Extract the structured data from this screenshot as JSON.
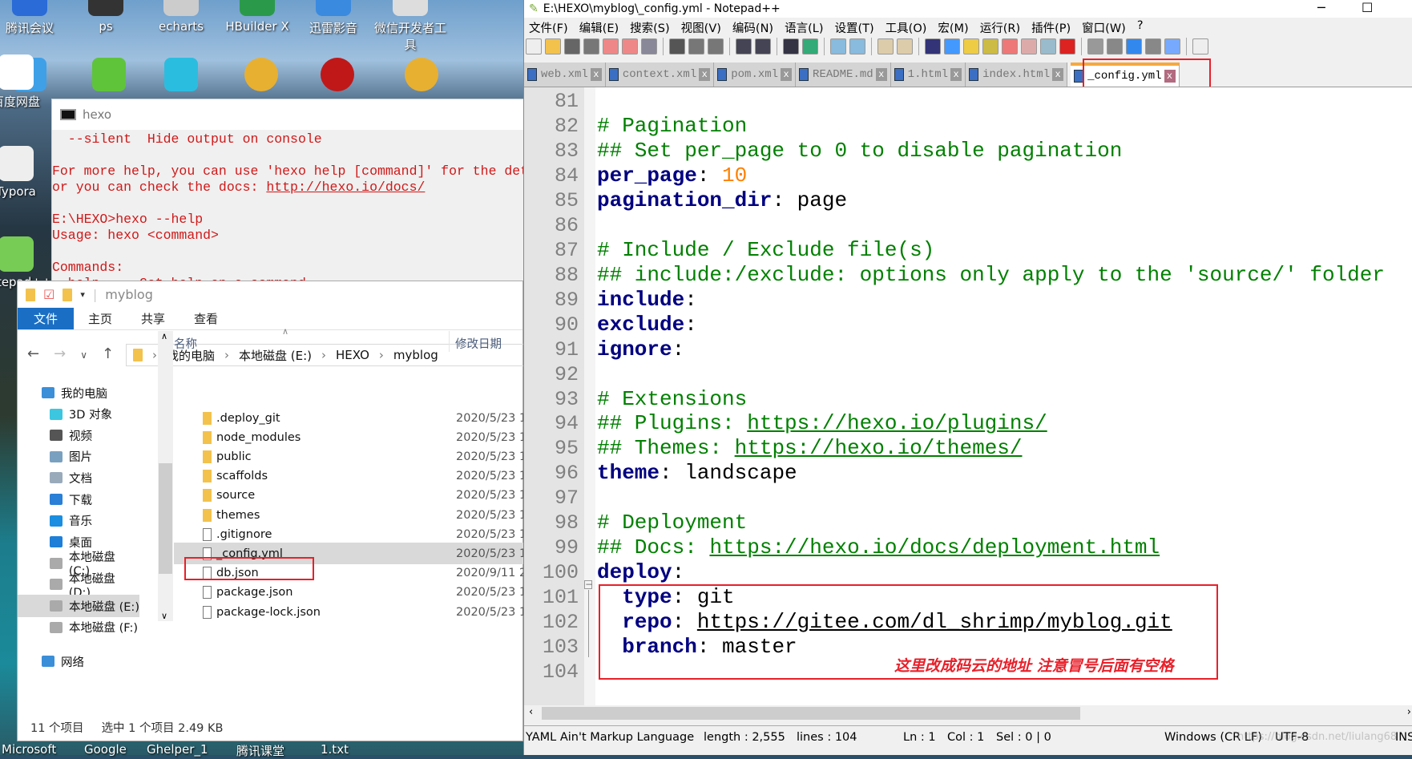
{
  "desktop": {
    "icons_top": [
      "腾讯会议",
      "ps",
      "echarts",
      "HBuilder X",
      "迅雷影音",
      "微信开发者工具"
    ],
    "icons_left": [
      "百度网盘",
      "Typora",
      "Notepad++"
    ],
    "taskbar_labels": [
      "Microsoft",
      "Google",
      "Ghelper_1",
      "腾讯课堂",
      "1.txt"
    ]
  },
  "console": {
    "title": "hexo",
    "lines": [
      "  --silent  Hide output on console",
      "",
      "For more help, you can use 'hexo help [command]' for the detailed information",
      "or you can check the docs: ",
      "",
      "E:\\HEXO>hexo --help",
      "Usage: hexo <command>",
      "",
      "Commands:",
      "  help     Get help on a command"
    ],
    "docs_link": "http://hexo.io/docs/"
  },
  "explorer": {
    "title": "myblog",
    "ribbon_tabs": [
      "文件",
      "主页",
      "共享",
      "查看"
    ],
    "breadcrumb": [
      "我的电脑",
      "本地磁盘 (E:)",
      "HEXO",
      "myblog"
    ],
    "nav_items": [
      {
        "label": "我的电脑",
        "icon": "computer-icon",
        "color": "#3a8fd8"
      },
      {
        "label": "3D 对象",
        "icon": "cube-icon",
        "color": "#3cc6e0"
      },
      {
        "label": "视频",
        "icon": "video-icon",
        "color": "#555"
      },
      {
        "label": "图片",
        "icon": "picture-icon",
        "color": "#7aa0c0"
      },
      {
        "label": "文档",
        "icon": "document-icon",
        "color": "#9ab"
      },
      {
        "label": "下载",
        "icon": "download-icon",
        "color": "#2a7fd6"
      },
      {
        "label": "音乐",
        "icon": "music-icon",
        "color": "#1a8ee0"
      },
      {
        "label": "桌面",
        "icon": "desktop-icon",
        "color": "#1e7fd8"
      },
      {
        "label": "本地磁盘 (C:)",
        "icon": "drive-icon",
        "color": "#aaa"
      },
      {
        "label": "本地磁盘 (D:)",
        "icon": "drive-icon",
        "color": "#aaa"
      },
      {
        "label": "本地磁盘 (E:)",
        "icon": "drive-icon",
        "color": "#aaa",
        "selected": true
      },
      {
        "label": "本地磁盘 (F:)",
        "icon": "drive-icon",
        "color": "#aaa"
      },
      {
        "label": "网络",
        "icon": "network-icon",
        "color": "#3a8fd8"
      }
    ],
    "columns": [
      "名称",
      "修改日期"
    ],
    "files": [
      {
        "name": ".deploy_git",
        "date": "2020/5/23 1",
        "type": "folder"
      },
      {
        "name": "node_modules",
        "date": "2020/5/23 1",
        "type": "folder"
      },
      {
        "name": "public",
        "date": "2020/5/23 1",
        "type": "folder"
      },
      {
        "name": "scaffolds",
        "date": "2020/5/23 1",
        "type": "folder"
      },
      {
        "name": "source",
        "date": "2020/5/23 1",
        "type": "folder"
      },
      {
        "name": "themes",
        "date": "2020/5/23 1",
        "type": "folder"
      },
      {
        "name": ".gitignore",
        "date": "2020/5/23 1",
        "type": "text"
      },
      {
        "name": "_config.yml",
        "date": "2020/5/23 1",
        "type": "file",
        "selected": true
      },
      {
        "name": "db.json",
        "date": "2020/9/11 2",
        "type": "json"
      },
      {
        "name": "package.json",
        "date": "2020/5/23 1",
        "type": "json"
      },
      {
        "name": "package-lock.json",
        "date": "2020/5/23 1",
        "type": "json"
      }
    ],
    "status_count": "11 个项目",
    "status_selected": "选中 1 个项目  2.49 KB"
  },
  "notepad": {
    "title": "E:\\HEXO\\myblog\\_config.yml - Notepad++",
    "menu": [
      "文件(F)",
      "编辑(E)",
      "搜索(S)",
      "视图(V)",
      "编码(N)",
      "语言(L)",
      "设置(T)",
      "工具(O)",
      "宏(M)",
      "运行(R)",
      "插件(P)",
      "窗口(W)",
      "?"
    ],
    "toolbar_icons": [
      "new-icon",
      "open-icon",
      "save-icon",
      "save-all-icon",
      "close-icon",
      "close-all-icon",
      "print-icon",
      "|",
      "cut-icon",
      "copy-icon",
      "paste-icon",
      "|",
      "undo-icon",
      "redo-icon",
      "|",
      "find-icon",
      "replace-icon",
      "|",
      "zoom-in-icon",
      "zoom-out-icon",
      "|",
      "sync-v-icon",
      "sync-h-icon",
      "|",
      "wrap-icon",
      "all-chars-icon",
      "indent-guide-icon",
      "udl-icon",
      "doc-map-icon",
      "function-list-icon",
      "folder-workspace-icon",
      "monitor-icon",
      "|",
      "record-macro-icon",
      "stop-macro-icon",
      "play-macro-icon",
      "run-macro-multiple-icon",
      "save-macro-icon",
      "|",
      "console-icon"
    ],
    "tabs": [
      "web.xml",
      "context.xml",
      "pom.xml",
      "README.md",
      "1.html",
      "index.html",
      "_config.yml"
    ],
    "active_tab": "_config.yml",
    "lines": [
      {
        "n": "81",
        "t": []
      },
      {
        "n": "82",
        "t": [
          [
            "c",
            "# Pagination"
          ]
        ]
      },
      {
        "n": "83",
        "t": [
          [
            "c",
            "## Set per_page to 0 to disable pagination"
          ]
        ]
      },
      {
        "n": "84",
        "t": [
          [
            "k",
            "per_page"
          ],
          [
            "v",
            ": "
          ],
          [
            "n",
            "10"
          ]
        ]
      },
      {
        "n": "85",
        "t": [
          [
            "k",
            "pagination_dir"
          ],
          [
            "v",
            ": page"
          ]
        ]
      },
      {
        "n": "86",
        "t": []
      },
      {
        "n": "87",
        "t": [
          [
            "c",
            "# Include / Exclude file(s)"
          ]
        ]
      },
      {
        "n": "88",
        "t": [
          [
            "c",
            "## include:/exclude: options only apply to the 'source/' folder"
          ]
        ]
      },
      {
        "n": "89",
        "t": [
          [
            "k",
            "include"
          ],
          [
            "v",
            ":"
          ]
        ]
      },
      {
        "n": "90",
        "t": [
          [
            "k",
            "exclude"
          ],
          [
            "v",
            ":"
          ]
        ]
      },
      {
        "n": "91",
        "t": [
          [
            "k",
            "ignore"
          ],
          [
            "v",
            ":"
          ]
        ]
      },
      {
        "n": "92",
        "t": []
      },
      {
        "n": "93",
        "t": [
          [
            "c",
            "# Extensions"
          ]
        ]
      },
      {
        "n": "94",
        "t": [
          [
            "c",
            "## Plugins: "
          ],
          [
            "c u",
            "https://hexo.io/plugins/"
          ]
        ]
      },
      {
        "n": "95",
        "t": [
          [
            "c",
            "## Themes: "
          ],
          [
            "c u",
            "https://hexo.io/themes/"
          ]
        ]
      },
      {
        "n": "96",
        "t": [
          [
            "k",
            "theme"
          ],
          [
            "v",
            ": landscape"
          ]
        ]
      },
      {
        "n": "97",
        "t": []
      },
      {
        "n": "98",
        "t": [
          [
            "c",
            "# Deployment"
          ]
        ]
      },
      {
        "n": "99",
        "t": [
          [
            "c",
            "## Docs: "
          ],
          [
            "c u",
            "https://hexo.io/docs/deployment.html"
          ]
        ]
      },
      {
        "n": "100",
        "t": [
          [
            "k",
            "deploy"
          ],
          [
            "v",
            ":"
          ]
        ]
      },
      {
        "n": "101",
        "t": [
          [
            "v",
            "  "
          ],
          [
            "k",
            "type"
          ],
          [
            "v",
            ": git"
          ]
        ]
      },
      {
        "n": "102",
        "t": [
          [
            "v",
            "  "
          ],
          [
            "k",
            "repo"
          ],
          [
            "v",
            ": "
          ],
          [
            "v u",
            "https://gitee.com/dl_shrimp/myblog.git"
          ]
        ]
      },
      {
        "n": "103",
        "t": [
          [
            "v",
            "  "
          ],
          [
            "k",
            "branch"
          ],
          [
            "v",
            ": master"
          ]
        ]
      },
      {
        "n": "104",
        "t": []
      }
    ],
    "annotation": "这里改成码云的地址   注意冒号后面有空格",
    "status": {
      "lang": "YAML Ain't Markup Language",
      "length": "length : 2,555",
      "lines": "lines : 104",
      "ln": "Ln : 1",
      "col": "Col : 1",
      "sel": "Sel : 0 | 0",
      "eol": "Windows (CR LF)",
      "enc": "UTF-8",
      "mode": "INS"
    },
    "watermark": "https://blog.csdn.net/liulang68"
  },
  "colors": {
    "comment": "#008000",
    "key": "#000080",
    "number": "#ff8000",
    "highlight": "#e8202a",
    "console_text": "#d01818",
    "ribbon_active": "#1a6fc4"
  }
}
